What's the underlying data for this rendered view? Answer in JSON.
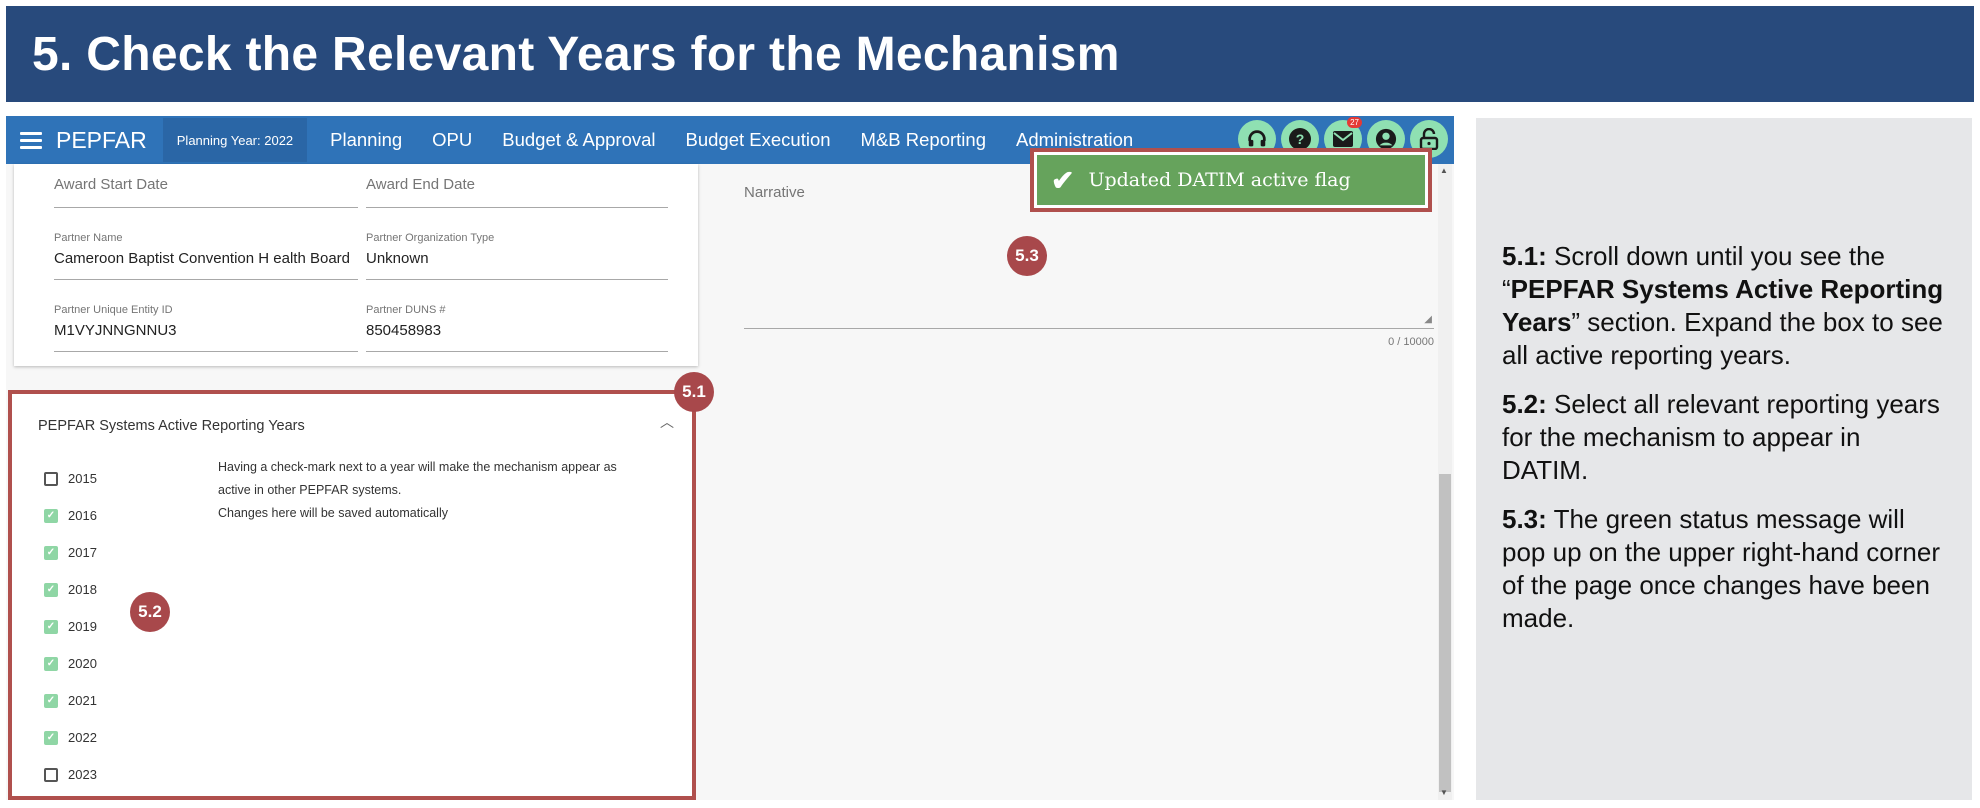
{
  "banner": {
    "title": "5. Check the Relevant Years for the Mechanism"
  },
  "nav": {
    "brand": "PEPFAR",
    "planning_year": "Planning Year: 2022",
    "items": [
      "Planning",
      "OPU",
      "Budget & Approval",
      "Budget Execution",
      "M&B Reporting",
      "Administration"
    ],
    "icons": [
      "headset-icon",
      "help-icon",
      "mail-icon",
      "account-icon",
      "unlock-icon"
    ],
    "mail_badge": "27"
  },
  "form": {
    "award_start_label": "Award Start Date",
    "award_end_label": "Award End Date",
    "partner_name_label": "Partner Name",
    "partner_name_value": "Cameroon Baptist Convention H ealth Board",
    "partner_org_type_label": "Partner Organization Type",
    "partner_org_type_value": "Unknown",
    "partner_uei_label": "Partner Unique Entity ID",
    "partner_uei_value": "M1VYJNNGNNU3",
    "partner_duns_label": "Partner DUNS #",
    "partner_duns_value": "850458983",
    "narrative_label": "Narrative",
    "narrative_count": "0 / 10000"
  },
  "toast": {
    "message": "Updated DATIM active flag"
  },
  "section": {
    "title": "PEPFAR Systems Active Reporting Years",
    "desc_line1": "Having a check-mark next to a year will make the mechanism appear as",
    "desc_line2": "active in other PEPFAR systems.",
    "desc_line3": "Changes here will be saved automatically",
    "years": [
      {
        "year": "2015",
        "checked": false
      },
      {
        "year": "2016",
        "checked": true
      },
      {
        "year": "2017",
        "checked": true
      },
      {
        "year": "2018",
        "checked": true
      },
      {
        "year": "2019",
        "checked": true
      },
      {
        "year": "2020",
        "checked": true
      },
      {
        "year": "2021",
        "checked": true
      },
      {
        "year": "2022",
        "checked": true
      },
      {
        "year": "2023",
        "checked": false
      }
    ]
  },
  "markers": {
    "m1": "5.1",
    "m2": "5.2",
    "m3": "5.3"
  },
  "instructions": {
    "step1_num": "5.1:",
    "step1_pre": " Scroll down until you see the “",
    "step1_bold": "PEPFAR Systems Active Reporting Years",
    "step1_post": "” section. Expand the box to see all active reporting years.",
    "step2_num": "5.2:",
    "step2_text": " Select all relevant reporting years for the mechanism to appear in DATIM.",
    "step3_num": "5.3:",
    "step3_text": " The green status message will pop up on the upper right-hand corner of the page once changes have been made."
  },
  "colors": {
    "banner": "#284a7c",
    "nav": "#2f73b8",
    "highlight": "#b0504d",
    "toast": "#66a35c",
    "check": "#8fd6a5"
  }
}
